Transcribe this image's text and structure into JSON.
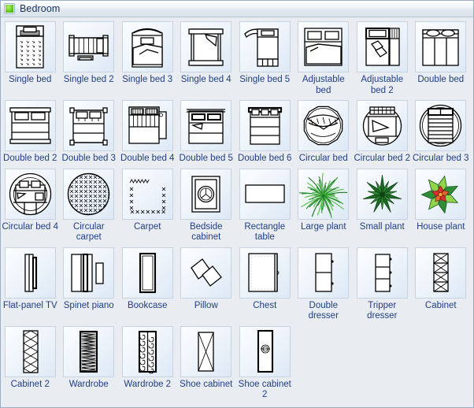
{
  "titlebar": {
    "icon": "stencil-green-square-icon",
    "title": "Bedroom"
  },
  "palette": {
    "columns": 8,
    "accent_text_color": "#1f3f87",
    "tile_border_color": "#c5d3e2",
    "panel_background": "#e9ecf0",
    "items": [
      {
        "label": "Single bed",
        "shape": "single-bed"
      },
      {
        "label": "Single bed 2",
        "shape": "single-bed-2"
      },
      {
        "label": "Single bed 3",
        "shape": "single-bed-3"
      },
      {
        "label": "Single bed 4",
        "shape": "single-bed-4"
      },
      {
        "label": "Single bed 5",
        "shape": "single-bed-5"
      },
      {
        "label": "Adjustable bed",
        "shape": "adjustable-bed"
      },
      {
        "label": "Adjustable bed 2",
        "shape": "adjustable-bed-2"
      },
      {
        "label": "Double bed",
        "shape": "double-bed"
      },
      {
        "label": "Double bed 2",
        "shape": "double-bed-2"
      },
      {
        "label": "Double bed 3",
        "shape": "double-bed-3"
      },
      {
        "label": "Double bed 4",
        "shape": "double-bed-4"
      },
      {
        "label": "Double bed 5",
        "shape": "double-bed-5"
      },
      {
        "label": "Double bed 6",
        "shape": "double-bed-6"
      },
      {
        "label": "Circular bed",
        "shape": "circular-bed"
      },
      {
        "label": "Circular bed 2",
        "shape": "circular-bed-2"
      },
      {
        "label": "Circular bed 3",
        "shape": "circular-bed-3"
      },
      {
        "label": "Circular bed 4",
        "shape": "circular-bed-4"
      },
      {
        "label": "Circular carpet",
        "shape": "circular-carpet"
      },
      {
        "label": "Carpet",
        "shape": "carpet"
      },
      {
        "label": "Bedside cabinet",
        "shape": "bedside-cabinet"
      },
      {
        "label": "Rectangle table",
        "shape": "rectangle-table"
      },
      {
        "label": "Large plant",
        "shape": "large-plant"
      },
      {
        "label": "Small plant",
        "shape": "small-plant"
      },
      {
        "label": "House plant",
        "shape": "house-plant"
      },
      {
        "label": "Flat-panel TV",
        "shape": "flat-panel-tv"
      },
      {
        "label": "Spinet piano",
        "shape": "spinet-piano"
      },
      {
        "label": "Bookcase",
        "shape": "bookcase"
      },
      {
        "label": "Pillow",
        "shape": "pillow"
      },
      {
        "label": "Chest",
        "shape": "chest"
      },
      {
        "label": "Double dresser",
        "shape": "double-dresser"
      },
      {
        "label": "Tripper dresser",
        "shape": "tripper-dresser"
      },
      {
        "label": "Cabinet",
        "shape": "cabinet"
      },
      {
        "label": "Cabinet 2",
        "shape": "cabinet-2"
      },
      {
        "label": "Wardrobe",
        "shape": "wardrobe"
      },
      {
        "label": "Wardrobe 2",
        "shape": "wardrobe-2"
      },
      {
        "label": "Shoe cabinet",
        "shape": "shoe-cabinet"
      },
      {
        "label": "Shoe cabinet 2",
        "shape": "shoe-cabinet-2"
      }
    ]
  }
}
